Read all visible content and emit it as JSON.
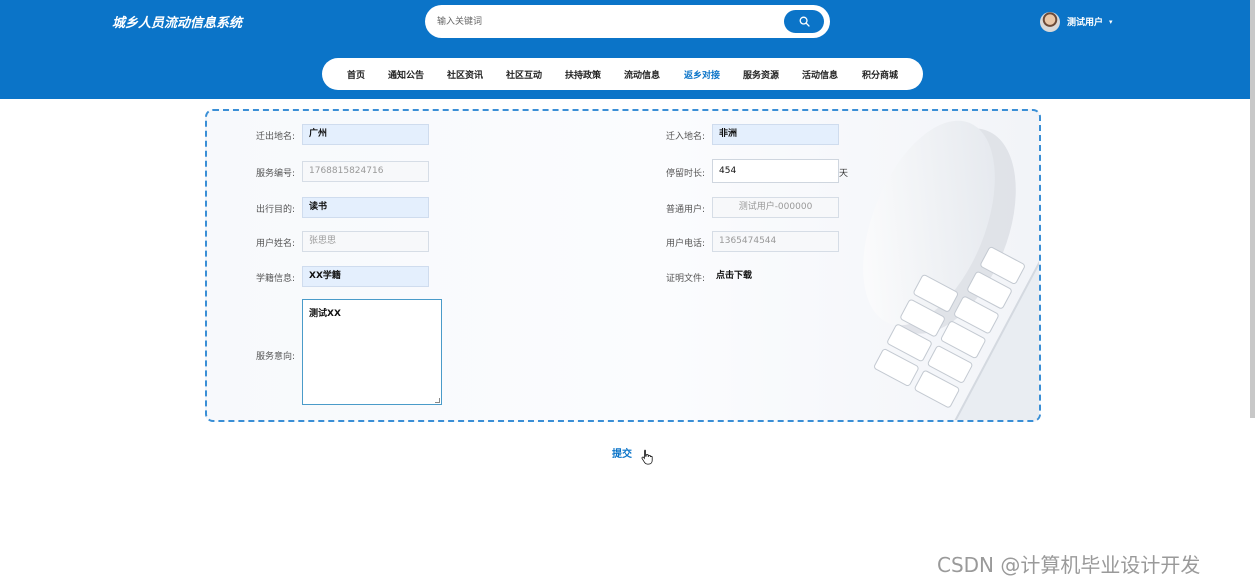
{
  "site": {
    "title": "城乡人员流动信息系统"
  },
  "search": {
    "placeholder": "输入关键词",
    "icon": "search-icon"
  },
  "user": {
    "name": "测试用户",
    "caret": "▾"
  },
  "nav": {
    "active": "返乡对接",
    "items": [
      "首页",
      "通知公告",
      "社区资讯",
      "社区互动",
      "扶持政策",
      "流动信息",
      "返乡对接",
      "服务资源",
      "活动信息",
      "积分商城"
    ]
  },
  "form": {
    "from_place": {
      "label": "迁出地名:",
      "value": "广州"
    },
    "to_place": {
      "label": "迁入地名:",
      "value": "非洲"
    },
    "service_no": {
      "label": "服务编号:",
      "value": "1768815824716"
    },
    "stay_duration": {
      "label": "停留时长:",
      "value": "454",
      "unit": "天"
    },
    "purpose": {
      "label": "出行目的:",
      "value": "读书"
    },
    "normal_user": {
      "label": "普通用户:",
      "value": "测试用户-000000"
    },
    "user_name": {
      "label": "用户姓名:",
      "value": "张思思"
    },
    "user_phone": {
      "label": "用户电话:",
      "value": "1365474544"
    },
    "student_info": {
      "label": "学籍信息:",
      "value": "XX学籍"
    },
    "proof_file": {
      "label": "证明文件:",
      "link": "点击下载"
    },
    "service_intent": {
      "label": "服务意向:",
      "value": "测试XX"
    }
  },
  "submit_label": "提交",
  "watermark": "CSDN @计算机毕业设计开发",
  "colors": {
    "brand": "#0b74c8",
    "highlight_field": "#e4effd"
  }
}
